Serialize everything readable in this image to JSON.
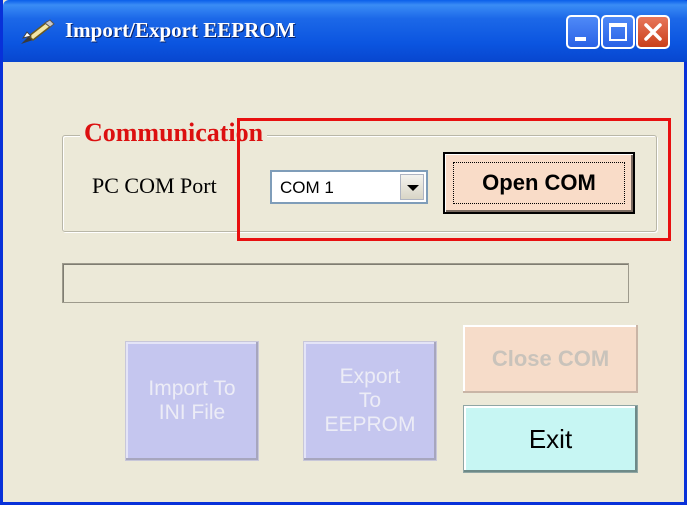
{
  "window": {
    "title": "Import/Export EEPROM",
    "title_icon": "pen-icon"
  },
  "communication": {
    "group_title": "Communication",
    "port_label": "PC COM Port",
    "port_selected": "COM 1",
    "open_button": "Open COM"
  },
  "progress": {
    "value": 0
  },
  "actions": {
    "import_button": "Import To\nINI File",
    "export_button": "Export\nTo\nEEPROM",
    "close_button": "Close COM",
    "exit_button": "Exit"
  },
  "colors": {
    "highlight": "#e81010",
    "legend": "#dc1010",
    "open_button_bg": "#f9dcc8",
    "exit_button_bg": "#c7f6f3",
    "disabled_button_bg": "#c5c6ef"
  }
}
